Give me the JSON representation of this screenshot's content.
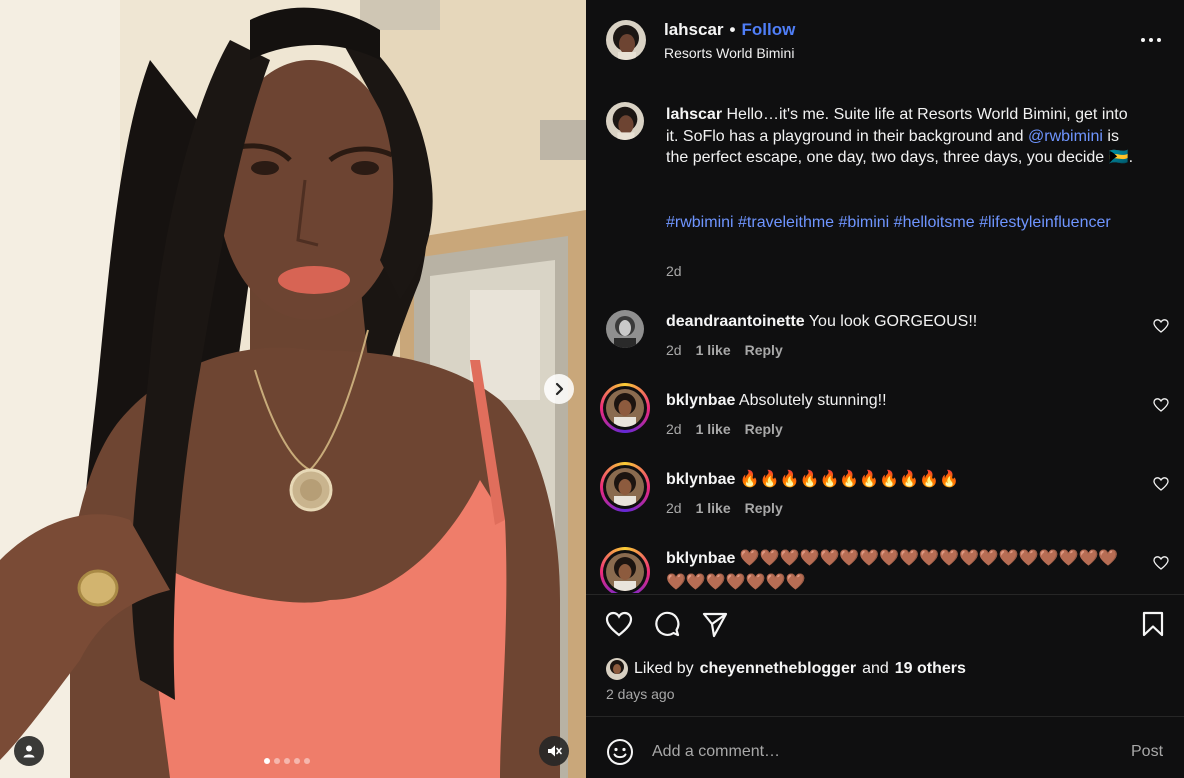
{
  "post": {
    "author": "lahscar",
    "separator": "•",
    "follow_label": "Follow",
    "location": "Resorts World Bimini",
    "caption": {
      "username": "lahscar",
      "text_1": " Hello…it's me. Suite life at Resorts World Bimini, get into it. SoFlo has a playground in their background and ",
      "mention": "@rwbimini",
      "text_2": " is the perfect escape, one day, two days, three days, you decide 🇧🇸.",
      "hashtags": [
        "#rwbimini",
        "#traveleithme",
        "#bimini",
        "#helloitsme",
        "#lifestyleinfluencer"
      ],
      "time": "2d"
    }
  },
  "comments": [
    {
      "username": "deandraantoinette",
      "text": "You look GORGEOUS!!",
      "time": "2d",
      "likes": "1 like",
      "reply": "Reply"
    },
    {
      "username": "bklynbae",
      "text": "Absolutely stunning!!",
      "time": "2d",
      "likes": "1 like",
      "reply": "Reply"
    },
    {
      "username": "bklynbae",
      "text": "🔥🔥🔥🔥🔥🔥🔥🔥🔥🔥🔥",
      "time": "2d",
      "likes": "1 like",
      "reply": "Reply"
    },
    {
      "username": "bklynbae",
      "text": "🤎🤎🤎🤎🤎🤎🤎🤎🤎🤎🤎🤎🤎🤎🤎🤎🤎🤎🤎🤎🤎🤎🤎🤎🤎🤎"
    }
  ],
  "likes": {
    "prefix": "Liked by",
    "user": "cheyennetheblogger",
    "middle": "and",
    "others": "19 others"
  },
  "post_time": "2 days ago",
  "comment_box": {
    "placeholder": "Add a comment…",
    "post_label": "Post"
  },
  "carousel": {
    "count": 5,
    "active_index": 0
  },
  "colors": {
    "panel_bg": "#0f0f10",
    "link": "#6f95ff",
    "follow": "#4f7ef7",
    "muted": "#a8a8a8",
    "dress": "#ef7d6a"
  }
}
